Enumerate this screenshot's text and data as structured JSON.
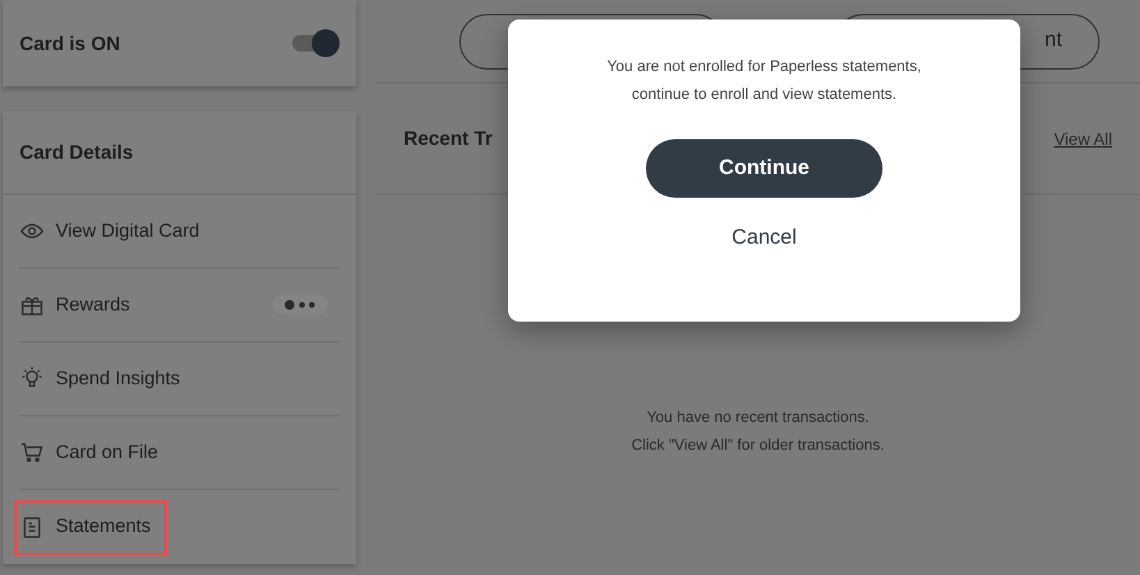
{
  "card_status": {
    "label": "Card is ON",
    "on": true
  },
  "card_details": {
    "title": "Card Details",
    "items": [
      {
        "kind": "eye",
        "label": "View Digital Card",
        "highlighted": false
      },
      {
        "kind": "gift",
        "label": "Rewards",
        "highlighted": false,
        "dots": true
      },
      {
        "kind": "bulb",
        "label": "Spend Insights",
        "highlighted": false
      },
      {
        "kind": "cart",
        "label": "Card on File",
        "highlighted": false
      },
      {
        "kind": "doc",
        "label": "Statements",
        "highlighted": true
      }
    ]
  },
  "top_buttons": [
    {
      "kind": "outline"
    },
    {
      "kind": "outline",
      "label": "nt"
    }
  ],
  "recent": {
    "title": "Recent Tr",
    "link": "View All",
    "empty_lines": [
      "You have no recent transactions.",
      "Click \"View All\" for older transactions."
    ]
  },
  "dialog": {
    "message": "You are not enrolled for Paperless statements, continue to enroll and view statements.",
    "buttons": [
      {
        "kind": "primary",
        "label": "Continue"
      },
      {
        "kind": "secondary",
        "label": "Cancel"
      }
    ]
  }
}
